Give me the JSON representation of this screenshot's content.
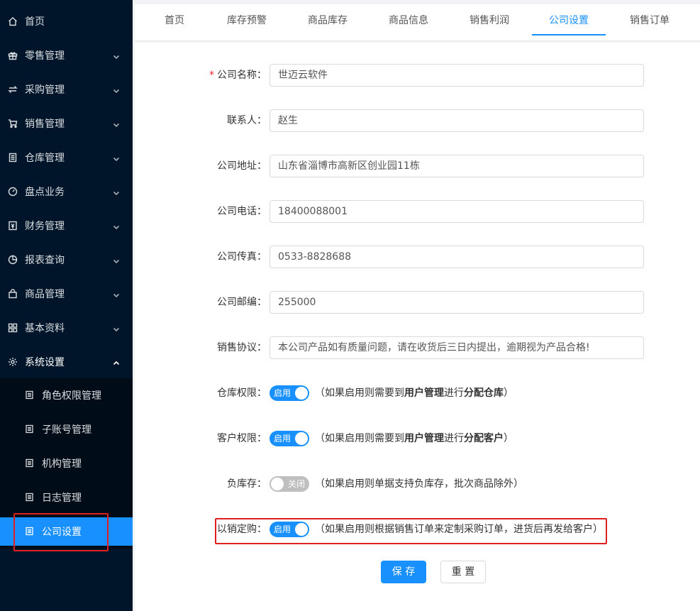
{
  "sidebar": {
    "items": [
      {
        "label": "首页",
        "icon": "home-icon"
      },
      {
        "label": "零售管理",
        "icon": "gift-icon"
      },
      {
        "label": "采购管理",
        "icon": "swap-icon"
      },
      {
        "label": "销售管理",
        "icon": "cart-icon"
      },
      {
        "label": "仓库管理",
        "icon": "warehouse-icon"
      },
      {
        "label": "盘点业务",
        "icon": "gauge-icon"
      },
      {
        "label": "财务管理",
        "icon": "finance-icon"
      },
      {
        "label": "报表查询",
        "icon": "pie-chart-icon"
      },
      {
        "label": "商品管理",
        "icon": "bag-icon"
      },
      {
        "label": "基本资料",
        "icon": "grid-icon"
      },
      {
        "label": "系统设置",
        "icon": "gear-icon"
      }
    ],
    "sub_items": [
      {
        "label": "角色权限管理",
        "icon": "doc-icon"
      },
      {
        "label": "子账号管理",
        "icon": "doc-icon"
      },
      {
        "label": "机构管理",
        "icon": "doc-icon"
      },
      {
        "label": "日志管理",
        "icon": "doc-icon"
      },
      {
        "label": "公司设置",
        "icon": "doc-icon"
      }
    ]
  },
  "tabs": [
    "首页",
    "库存预警",
    "商品库存",
    "商品信息",
    "销售利润",
    "公司设置",
    "销售订单"
  ],
  "active_tab": "公司设置",
  "form": {
    "company_name": {
      "label": "公司名称：",
      "required_mark": "*",
      "value": "世迈云软件"
    },
    "contact": {
      "label": "联系人：",
      "value": "赵生"
    },
    "address": {
      "label": "公司地址：",
      "value": "山东省淄博市高新区创业园11栋"
    },
    "phone": {
      "label": "公司电话：",
      "value": "18400088001"
    },
    "fax": {
      "label": "公司传真：",
      "value": "0533-8828688"
    },
    "postcode": {
      "label": "公司邮编：",
      "value": "255000"
    },
    "agreement": {
      "label": "销售协议：",
      "value": "本公司产品如有质量问题，请在收货后三日内提出，逾期视为产品合格!"
    },
    "warehouse_perm": {
      "label": "仓库权限：",
      "switch_text": "启用",
      "on": true,
      "hint_pre": "（如果启用则需要到",
      "hint_b1": "用户管理",
      "hint_mid": "进行",
      "hint_b2": "分配仓库",
      "hint_post": "）"
    },
    "customer_perm": {
      "label": "客户权限：",
      "switch_text": "启用",
      "on": true,
      "hint_pre": "（如果启用则需要到",
      "hint_b1": "用户管理",
      "hint_mid": "进行",
      "hint_b2": "分配客户",
      "hint_post": "）"
    },
    "negative_stock": {
      "label": "负库存：",
      "switch_text": "关闭",
      "on": false,
      "hint": "（如果启用则单据支持负库存，批次商品除外）"
    },
    "sale_to_purchase": {
      "label": "以销定购：",
      "switch_text": "启用",
      "on": true,
      "hint": "（如果启用则根据销售订单来定制采购订单，进货后再发给客户）"
    }
  },
  "buttons": {
    "save": "保 存",
    "reset": "重 置"
  },
  "colors": {
    "sidebar_bg": "#001529",
    "accent": "#1890ff",
    "highlight": "#e02020"
  }
}
